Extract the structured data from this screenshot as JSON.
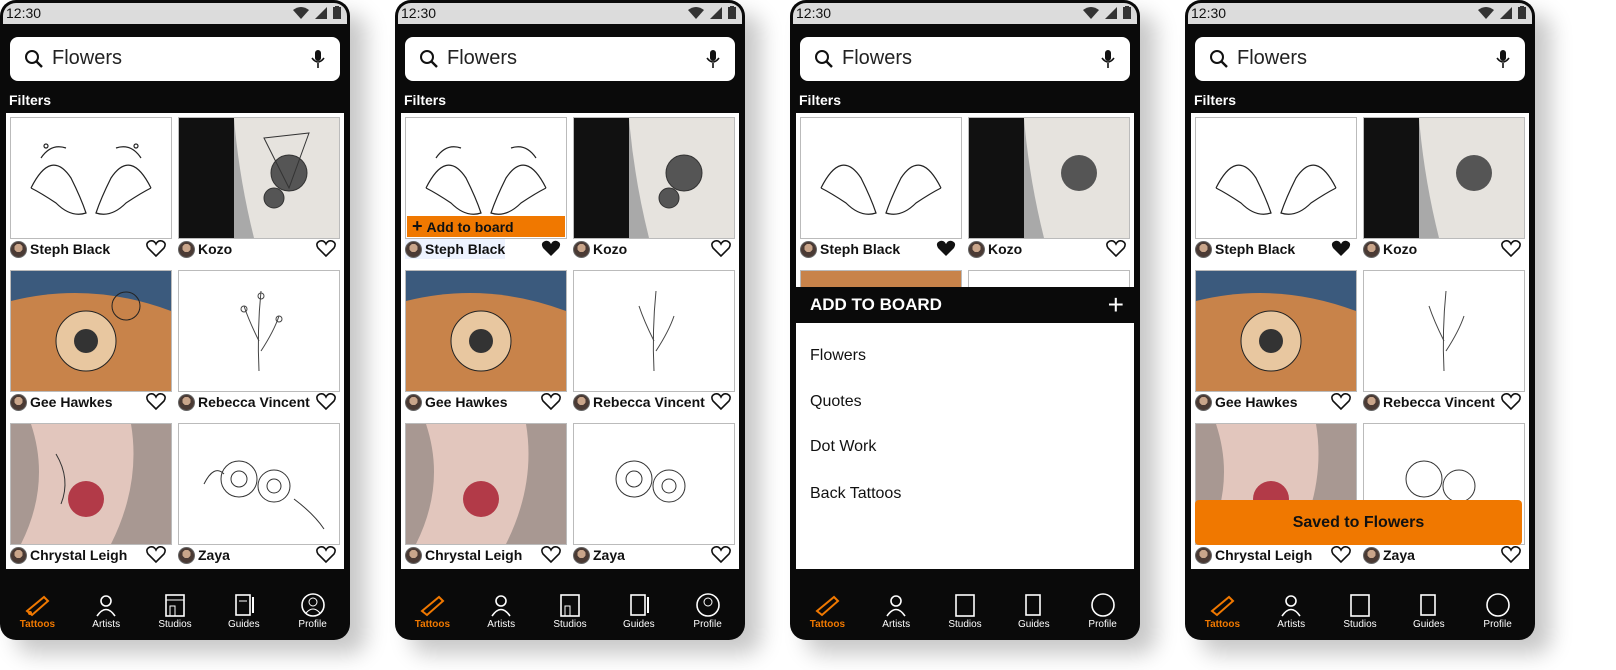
{
  "status": {
    "time": "12:30"
  },
  "search": {
    "query": "Flowers"
  },
  "filters_label": "Filters",
  "tiles": [
    {
      "artist": "Steph Black"
    },
    {
      "artist": "Kozo"
    },
    {
      "artist": "Gee Hawkes"
    },
    {
      "artist": "Rebecca Vincent"
    },
    {
      "artist": "Chrystal Leigh"
    },
    {
      "artist": "Zaya"
    }
  ],
  "add_to_board_label": "Add to board",
  "sheet": {
    "title": "ADD TO BOARD",
    "add_symbol": "+",
    "boards": [
      "Flowers",
      "Quotes",
      "Dot Work",
      "Back Tattoos"
    ]
  },
  "toast": "Saved to Flowers",
  "nav": [
    "Tattoos",
    "Artists",
    "Studios",
    "Guides",
    "Profile"
  ],
  "colors": {
    "accent": "#f07800",
    "dark": "#0a0a0a"
  }
}
